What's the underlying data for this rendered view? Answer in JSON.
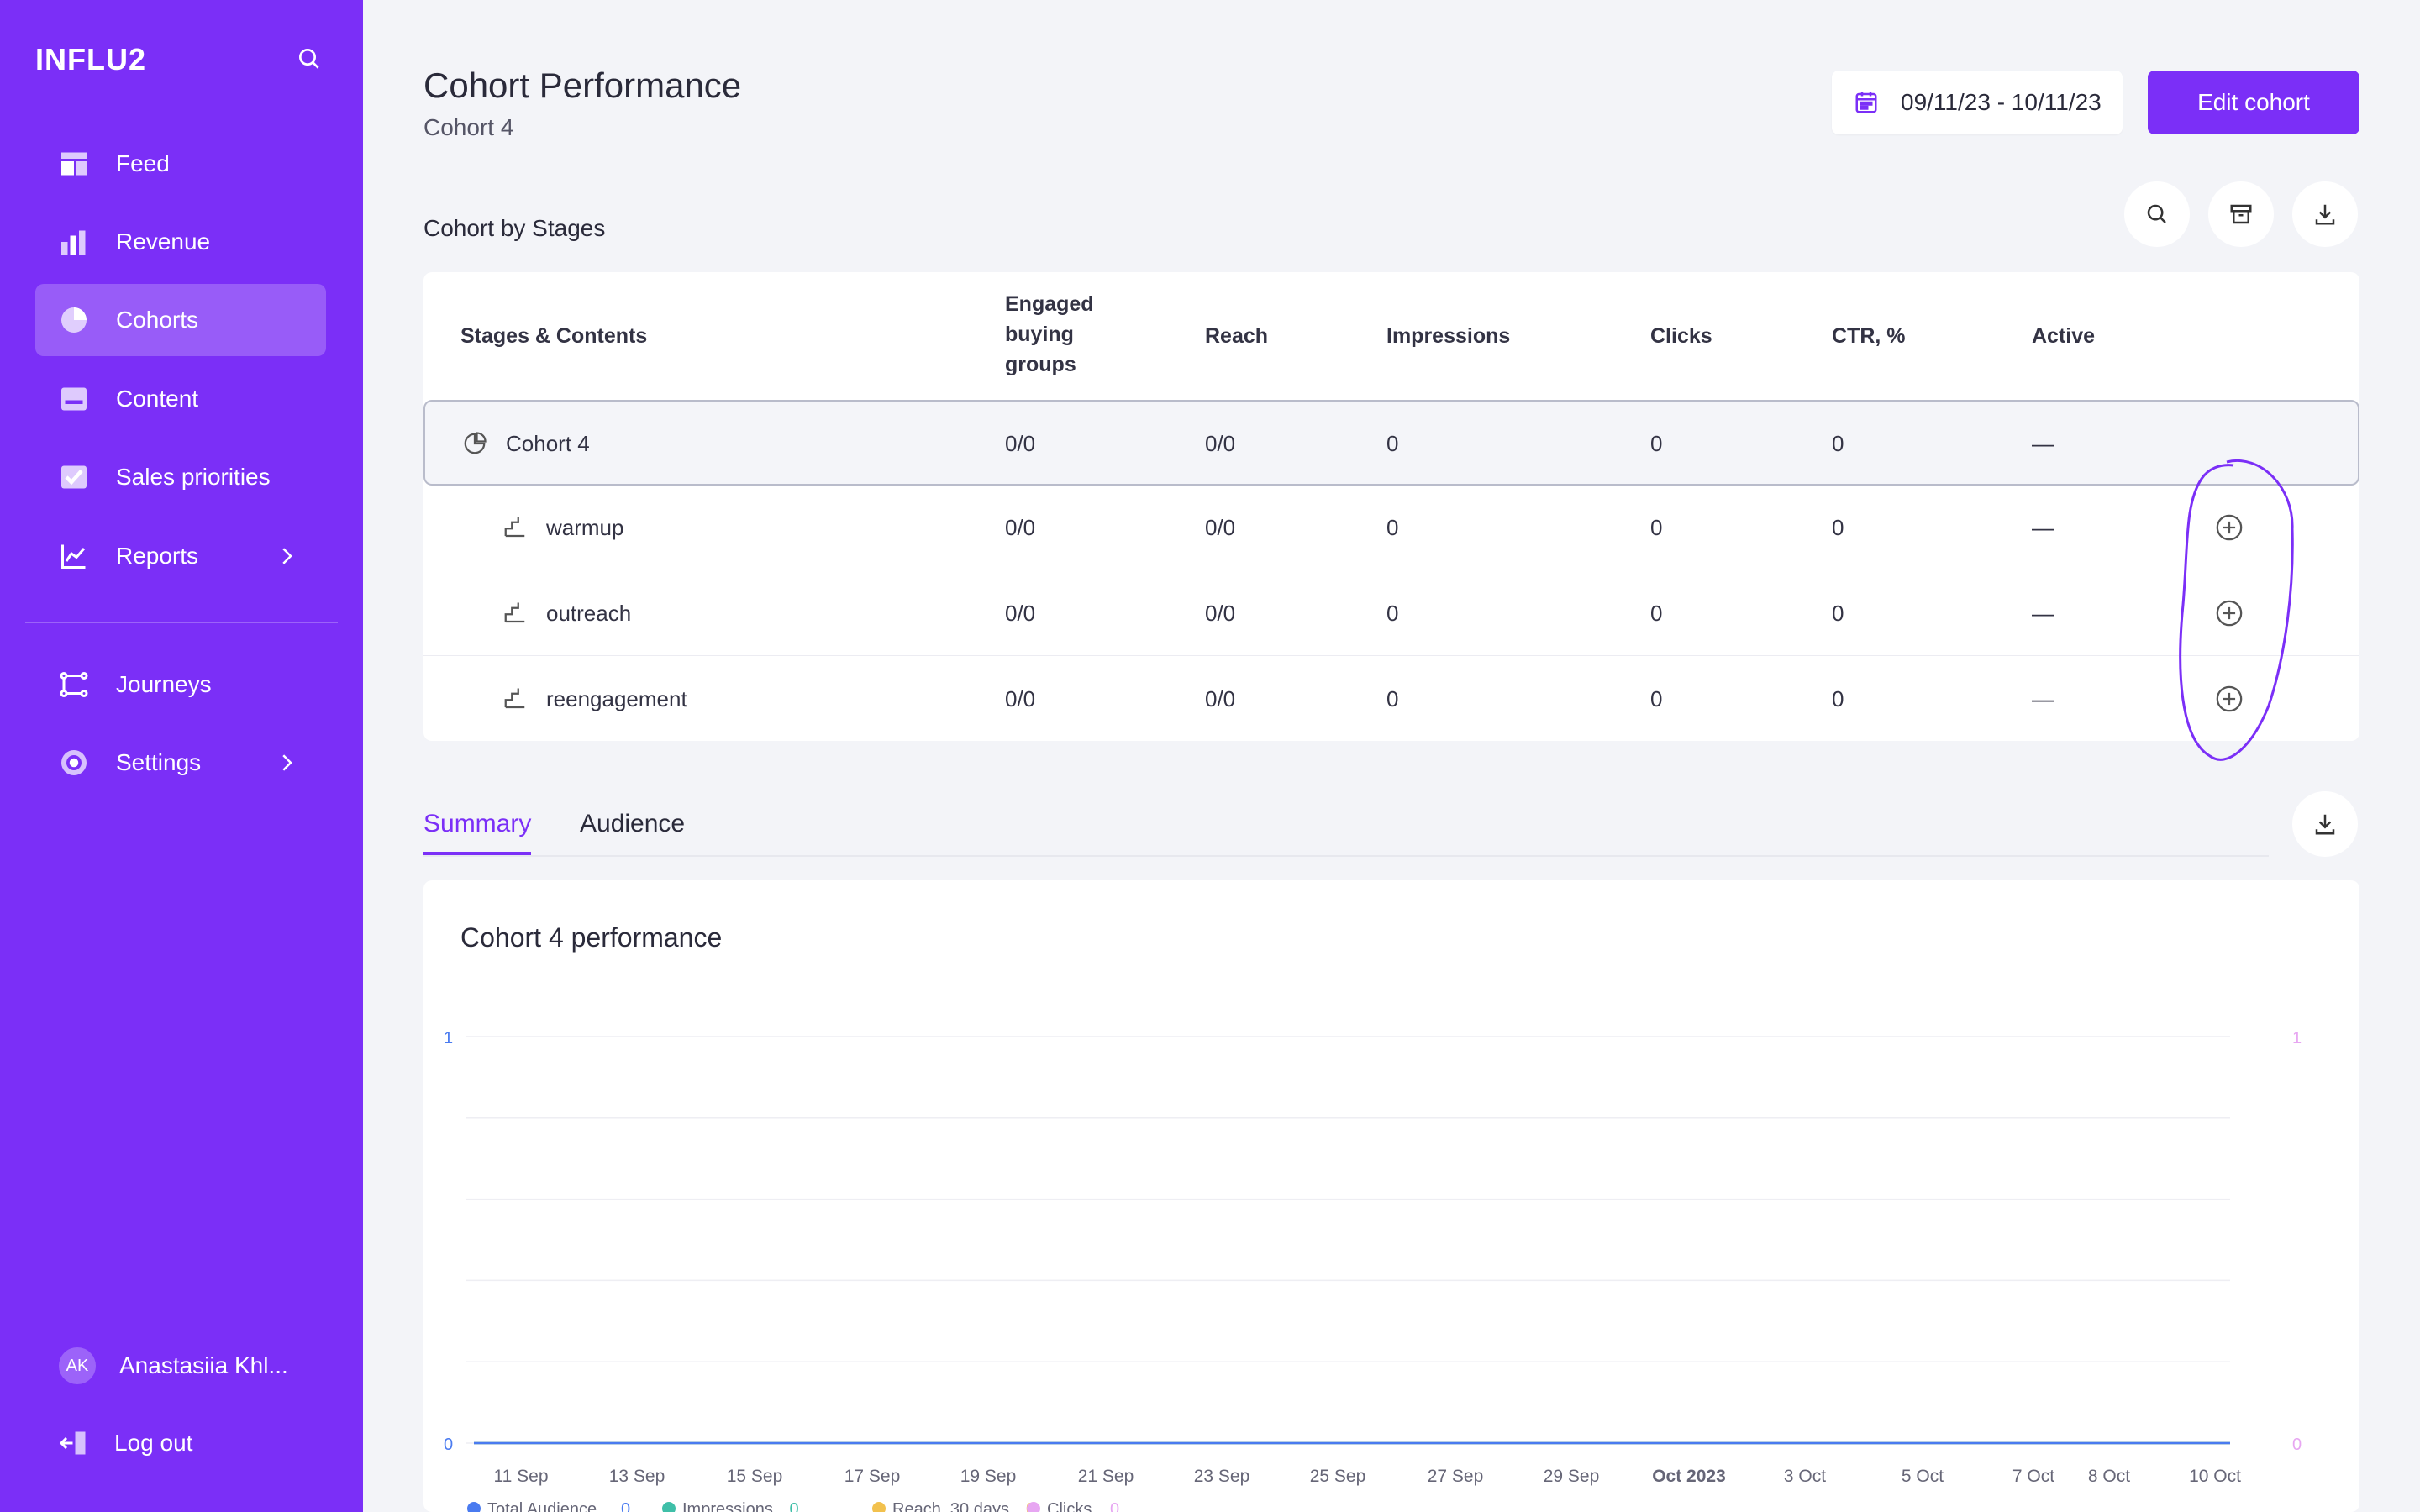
{
  "sidebar": {
    "brand": "INFLU2",
    "items": [
      {
        "label": "Feed",
        "icon": "feed-icon"
      },
      {
        "label": "Revenue",
        "icon": "bar-chart-icon"
      },
      {
        "label": "Cohorts",
        "icon": "pie-chart-icon",
        "active": true
      },
      {
        "label": "Content",
        "icon": "content-icon"
      },
      {
        "label": "Sales priorities",
        "icon": "checkbox-icon"
      },
      {
        "label": "Reports",
        "icon": "line-chart-icon",
        "has_submenu": true
      },
      {
        "label": "Journeys",
        "icon": "journeys-icon"
      },
      {
        "label": "Settings",
        "icon": "gear-icon",
        "has_submenu": true
      }
    ],
    "user": {
      "initials": "AK",
      "name": "Anastasiia Khl..."
    },
    "logout": "Log out"
  },
  "header": {
    "title": "Cohort Performance",
    "subtitle": "Cohort 4",
    "date_range": "09/11/23 - 10/11/23",
    "edit_button": "Edit cohort"
  },
  "stages": {
    "section_title": "Cohort by Stages",
    "columns": [
      "Stages & Contents",
      "Engaged buying groups",
      "Reach",
      "Impressions",
      "Clicks",
      "CTR, %",
      "Active"
    ],
    "columns_wrapped": {
      "engaged": [
        "Engaged",
        "buying",
        "groups"
      ]
    },
    "rows": [
      {
        "name": "Cohort 4",
        "engaged": "0/0",
        "reach": "0/0",
        "impressions": "0",
        "clicks": "0",
        "ctr": "0",
        "active": "—"
      },
      {
        "name": "warmup",
        "engaged": "0/0",
        "reach": "0/0",
        "impressions": "0",
        "clicks": "0",
        "ctr": "0",
        "active": "—"
      },
      {
        "name": "outreach",
        "engaged": "0/0",
        "reach": "0/0",
        "impressions": "0",
        "clicks": "0",
        "ctr": "0",
        "active": "—"
      },
      {
        "name": "reengagement",
        "engaged": "0/0",
        "reach": "0/0",
        "impressions": "0",
        "clicks": "0",
        "ctr": "0",
        "active": "—"
      }
    ]
  },
  "tabs": [
    {
      "label": "Summary",
      "active": true
    },
    {
      "label": "Audience",
      "active": false
    }
  ],
  "colors": {
    "accent": "#7b2ff7",
    "total_audience": "#4a7bf0",
    "impressions": "#3fbfa8",
    "reach": "#f2c14e",
    "clicks": "#e7a6f2"
  },
  "chart_data": {
    "type": "line",
    "title": "Cohort 4 performance",
    "x_ticks": [
      "11 Sep",
      "13 Sep",
      "15 Sep",
      "17 Sep",
      "19 Sep",
      "21 Sep",
      "23 Sep",
      "25 Sep",
      "27 Sep",
      "29 Sep",
      "Oct 2023",
      "3 Oct",
      "5 Oct",
      "7 Oct",
      "8 Oct",
      "10 Oct"
    ],
    "y_left_ticks": [
      "1",
      "0"
    ],
    "y_right_ticks": [
      "1",
      "0"
    ],
    "ylim": [
      0,
      1
    ],
    "grid": true,
    "legend_position": "bottom-left",
    "series": [
      {
        "name": "Total Audience",
        "total": "0",
        "values": [
          0,
          0
        ]
      },
      {
        "name": "Impressions",
        "total": "0",
        "values": [
          0,
          0
        ]
      },
      {
        "name": "Reach, 30 days",
        "total": "0",
        "values": [
          0,
          0
        ]
      },
      {
        "name": "Clicks",
        "total": "0",
        "values": [
          0,
          0
        ]
      }
    ]
  }
}
